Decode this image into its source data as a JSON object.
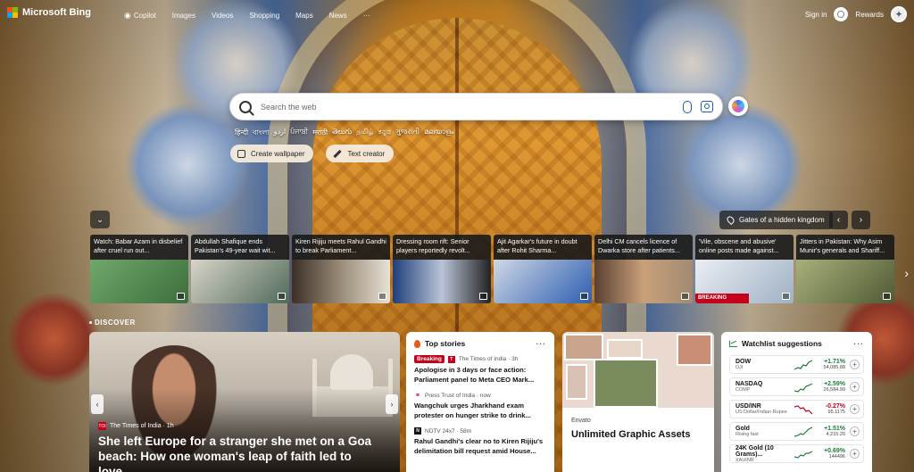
{
  "header": {
    "brand": "Microsoft Bing",
    "nav": [
      {
        "label": "Copilot",
        "icon": "copilot-icon"
      },
      {
        "label": "Images"
      },
      {
        "label": "Videos"
      },
      {
        "label": "Shopping"
      },
      {
        "label": "Maps"
      },
      {
        "label": "News"
      },
      {
        "label": "···"
      }
    ],
    "sign_in": "Sign in",
    "rewards": "Rewards"
  },
  "search": {
    "placeholder": "Search the web"
  },
  "languages": [
    "हिन्दी",
    "বাংলা",
    "اردو",
    "ਪੰਜਾਬੀ",
    "मराठी",
    "తెలుగు",
    "தமிழ்",
    "ಕನ್ನಡ",
    "ગુજરાતી",
    "മലയാളം"
  ],
  "actions": {
    "wallpaper": "Create wallpaper",
    "text_creator": "Text creator"
  },
  "image_caption": "Gates of a hidden kingdom",
  "news_strip": [
    {
      "text": "Watch: Babar Azam in disbelief after cruel run out...",
      "color": "#4c8a4b"
    },
    {
      "text": "Abdullah Shafique ends Pakistan's 49-year wait wit...",
      "color": "#5b7d6a"
    },
    {
      "text": "Kiren Rijiju meets Rahul Gandhi to break Parliament...",
      "color": "#7a6a55"
    },
    {
      "text": "Dressing room rift: Senior players reportedly revolt...",
      "color": "#2d4f8a"
    },
    {
      "text": "Ajit Agarkar's future in doubt after Rohit Sharma...",
      "color": "#2f5fa8"
    },
    {
      "text": "Delhi CM cancels licence of Dwarka store after patients...",
      "color": "#8a6a50"
    },
    {
      "text": "'Vile, obscene and abusive' online posts made against...",
      "color": "#b9c3cf",
      "badge": "BREAKING"
    },
    {
      "text": "Jitters in Pakistan: Why Asim Munir's generals and Shariff...",
      "color": "#6b7a4a"
    }
  ],
  "discover": {
    "label": "DISCOVER",
    "hero": {
      "source": "The Times of India · 1h",
      "title": "She left Europe for a stranger she met on a Goa beach: How one woman's leap of faith led to love,..."
    }
  },
  "top_stories": {
    "title": "Top stories",
    "items": [
      {
        "badge": "Breaking",
        "source": "The Times of India · 3h",
        "headline": "Apologise in 3 days or face action: Parliament panel to Meta CEO Mark..."
      },
      {
        "source": "Press Trust of India · now",
        "headline": "Wangchuk urges Jharkhand exam protester on hunger strike to drink..."
      },
      {
        "source": "NDTV 24x7 · 58m",
        "headline": "Rahul Gandhi's clear no to Kiren Rijiju's delimitation bill request amid House..."
      }
    ]
  },
  "ad": {
    "brand": "Envato",
    "title": "Unlimited Graphic Assets"
  },
  "watchlist": {
    "title": "Watchlist suggestions",
    "items": [
      {
        "symbol": "DOW",
        "name": "DJI",
        "change": "+1.71%",
        "price": "54,085.88",
        "dir": "up"
      },
      {
        "symbol": "NASDAQ",
        "name": "COMP",
        "change": "+2.59%",
        "price": "26,584.99",
        "dir": "up"
      },
      {
        "symbol": "USD/INR",
        "name": "US Dollar/Indian Rupee",
        "change": "-0.27%",
        "price": "95.1175",
        "dir": "down"
      },
      {
        "symbol": "Gold",
        "name": "Rising fast",
        "change": "+1.51%",
        "price": "4,215.20",
        "dir": "up"
      },
      {
        "symbol": "24K Gold (10 Grams)...",
        "name": "XAUINR",
        "change": "+0.69%",
        "price": "144496",
        "dir": "up"
      }
    ]
  },
  "colors": {
    "breaking": "#c4001a",
    "up": "#1e7d32",
    "down": "#c4001a",
    "search_accent": "#1a5fb4"
  }
}
